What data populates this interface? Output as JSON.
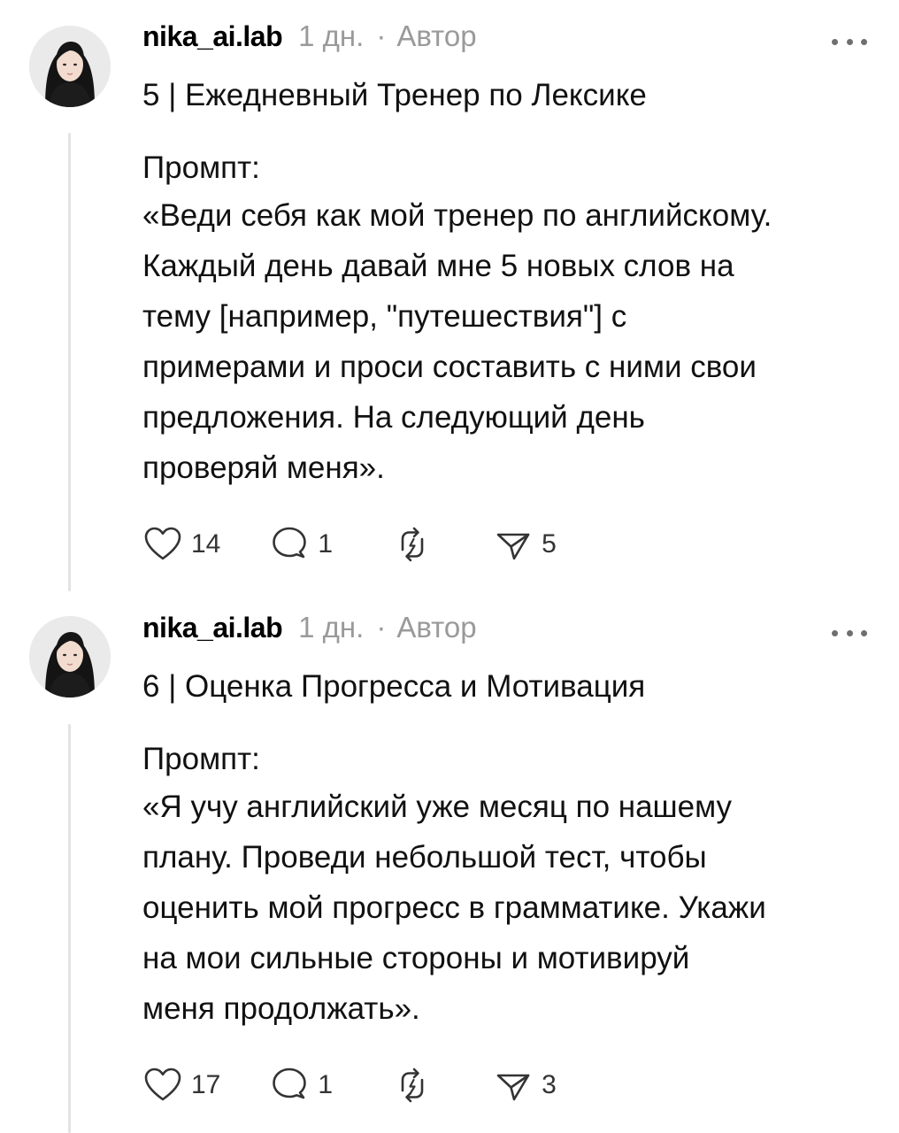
{
  "posts": [
    {
      "username": "nika_ai.lab",
      "time": "1 дн.",
      "separator": "·",
      "author_label": "Автор",
      "title": "5 | Ежедневный Тренер по Лексике",
      "prompt_label": "Промпт:",
      "prompt_lines": [
        "«Веди себя как мой тренер по английскому.",
        "Каждый день давай мне 5 новых слов на",
        "тему [например, \"путешествия\"] с",
        "примерами и проси составить с ними свои",
        "предложения. На следующий день",
        "проверяй меня»."
      ],
      "likes": "14",
      "comments": "1",
      "shares": "5"
    },
    {
      "username": "nika_ai.lab",
      "time": "1 дн.",
      "separator": "·",
      "author_label": "Автор",
      "title": "6 | Оценка Прогресса и Мотивация",
      "prompt_label": "Промпт:",
      "prompt_lines": [
        "«Я учу английский уже месяц по нашему",
        "плану. Проведи небольшой тест, чтобы",
        "оценить мой прогресс в грамматике. Укажи",
        "на мои сильные стороны и мотивируй",
        "меня продолжать»."
      ],
      "likes": "17",
      "comments": "1",
      "shares": "3"
    }
  ],
  "icons": {
    "like": "heart-icon",
    "comment": "comment-icon",
    "repost": "repost-icon",
    "share": "send-icon",
    "more": "more-dots-icon"
  },
  "colors": {
    "text": "#111111",
    "muted": "#9a9a9a",
    "thread_line": "#e3e3e3",
    "icon": "#333333"
  }
}
